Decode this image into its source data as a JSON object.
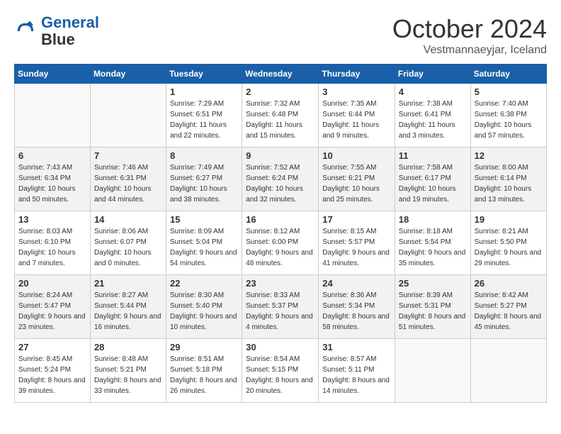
{
  "header": {
    "logo_line1": "General",
    "logo_line2": "Blue",
    "month": "October 2024",
    "location": "Vestmannaeyjar, Iceland"
  },
  "days_of_week": [
    "Sunday",
    "Monday",
    "Tuesday",
    "Wednesday",
    "Thursday",
    "Friday",
    "Saturday"
  ],
  "weeks": [
    [
      {
        "day": "",
        "sunrise": "",
        "sunset": "",
        "daylight": ""
      },
      {
        "day": "",
        "sunrise": "",
        "sunset": "",
        "daylight": ""
      },
      {
        "day": "1",
        "sunrise": "Sunrise: 7:29 AM",
        "sunset": "Sunset: 6:51 PM",
        "daylight": "Daylight: 11 hours and 22 minutes."
      },
      {
        "day": "2",
        "sunrise": "Sunrise: 7:32 AM",
        "sunset": "Sunset: 6:48 PM",
        "daylight": "Daylight: 11 hours and 15 minutes."
      },
      {
        "day": "3",
        "sunrise": "Sunrise: 7:35 AM",
        "sunset": "Sunset: 6:44 PM",
        "daylight": "Daylight: 11 hours and 9 minutes."
      },
      {
        "day": "4",
        "sunrise": "Sunrise: 7:38 AM",
        "sunset": "Sunset: 6:41 PM",
        "daylight": "Daylight: 11 hours and 3 minutes."
      },
      {
        "day": "5",
        "sunrise": "Sunrise: 7:40 AM",
        "sunset": "Sunset: 6:38 PM",
        "daylight": "Daylight: 10 hours and 57 minutes."
      }
    ],
    [
      {
        "day": "6",
        "sunrise": "Sunrise: 7:43 AM",
        "sunset": "Sunset: 6:34 PM",
        "daylight": "Daylight: 10 hours and 50 minutes."
      },
      {
        "day": "7",
        "sunrise": "Sunrise: 7:46 AM",
        "sunset": "Sunset: 6:31 PM",
        "daylight": "Daylight: 10 hours and 44 minutes."
      },
      {
        "day": "8",
        "sunrise": "Sunrise: 7:49 AM",
        "sunset": "Sunset: 6:27 PM",
        "daylight": "Daylight: 10 hours and 38 minutes."
      },
      {
        "day": "9",
        "sunrise": "Sunrise: 7:52 AM",
        "sunset": "Sunset: 6:24 PM",
        "daylight": "Daylight: 10 hours and 32 minutes."
      },
      {
        "day": "10",
        "sunrise": "Sunrise: 7:55 AM",
        "sunset": "Sunset: 6:21 PM",
        "daylight": "Daylight: 10 hours and 25 minutes."
      },
      {
        "day": "11",
        "sunrise": "Sunrise: 7:58 AM",
        "sunset": "Sunset: 6:17 PM",
        "daylight": "Daylight: 10 hours and 19 minutes."
      },
      {
        "day": "12",
        "sunrise": "Sunrise: 8:00 AM",
        "sunset": "Sunset: 6:14 PM",
        "daylight": "Daylight: 10 hours and 13 minutes."
      }
    ],
    [
      {
        "day": "13",
        "sunrise": "Sunrise: 8:03 AM",
        "sunset": "Sunset: 6:10 PM",
        "daylight": "Daylight: 10 hours and 7 minutes."
      },
      {
        "day": "14",
        "sunrise": "Sunrise: 8:06 AM",
        "sunset": "Sunset: 6:07 PM",
        "daylight": "Daylight: 10 hours and 0 minutes."
      },
      {
        "day": "15",
        "sunrise": "Sunrise: 8:09 AM",
        "sunset": "Sunset: 5:04 PM",
        "daylight": "Daylight: 9 hours and 54 minutes."
      },
      {
        "day": "16",
        "sunrise": "Sunrise: 8:12 AM",
        "sunset": "Sunset: 6:00 PM",
        "daylight": "Daylight: 9 hours and 48 minutes."
      },
      {
        "day": "17",
        "sunrise": "Sunrise: 8:15 AM",
        "sunset": "Sunset: 5:57 PM",
        "daylight": "Daylight: 9 hours and 41 minutes."
      },
      {
        "day": "18",
        "sunrise": "Sunrise: 8:18 AM",
        "sunset": "Sunset: 5:54 PM",
        "daylight": "Daylight: 9 hours and 35 minutes."
      },
      {
        "day": "19",
        "sunrise": "Sunrise: 8:21 AM",
        "sunset": "Sunset: 5:50 PM",
        "daylight": "Daylight: 9 hours and 29 minutes."
      }
    ],
    [
      {
        "day": "20",
        "sunrise": "Sunrise: 8:24 AM",
        "sunset": "Sunset: 5:47 PM",
        "daylight": "Daylight: 9 hours and 23 minutes."
      },
      {
        "day": "21",
        "sunrise": "Sunrise: 8:27 AM",
        "sunset": "Sunset: 5:44 PM",
        "daylight": "Daylight: 9 hours and 16 minutes."
      },
      {
        "day": "22",
        "sunrise": "Sunrise: 8:30 AM",
        "sunset": "Sunset: 5:40 PM",
        "daylight": "Daylight: 9 hours and 10 minutes."
      },
      {
        "day": "23",
        "sunrise": "Sunrise: 8:33 AM",
        "sunset": "Sunset: 5:37 PM",
        "daylight": "Daylight: 9 hours and 4 minutes."
      },
      {
        "day": "24",
        "sunrise": "Sunrise: 8:36 AM",
        "sunset": "Sunset: 5:34 PM",
        "daylight": "Daylight: 8 hours and 58 minutes."
      },
      {
        "day": "25",
        "sunrise": "Sunrise: 8:39 AM",
        "sunset": "Sunset: 5:31 PM",
        "daylight": "Daylight: 8 hours and 51 minutes."
      },
      {
        "day": "26",
        "sunrise": "Sunrise: 8:42 AM",
        "sunset": "Sunset: 5:27 PM",
        "daylight": "Daylight: 8 hours and 45 minutes."
      }
    ],
    [
      {
        "day": "27",
        "sunrise": "Sunrise: 8:45 AM",
        "sunset": "Sunset: 5:24 PM",
        "daylight": "Daylight: 8 hours and 39 minutes."
      },
      {
        "day": "28",
        "sunrise": "Sunrise: 8:48 AM",
        "sunset": "Sunset: 5:21 PM",
        "daylight": "Daylight: 8 hours and 33 minutes."
      },
      {
        "day": "29",
        "sunrise": "Sunrise: 8:51 AM",
        "sunset": "Sunset: 5:18 PM",
        "daylight": "Daylight: 8 hours and 26 minutes."
      },
      {
        "day": "30",
        "sunrise": "Sunrise: 8:54 AM",
        "sunset": "Sunset: 5:15 PM",
        "daylight": "Daylight: 8 hours and 20 minutes."
      },
      {
        "day": "31",
        "sunrise": "Sunrise: 8:57 AM",
        "sunset": "Sunset: 5:11 PM",
        "daylight": "Daylight: 8 hours and 14 minutes."
      },
      {
        "day": "",
        "sunrise": "",
        "sunset": "",
        "daylight": ""
      },
      {
        "day": "",
        "sunrise": "",
        "sunset": "",
        "daylight": ""
      }
    ]
  ]
}
